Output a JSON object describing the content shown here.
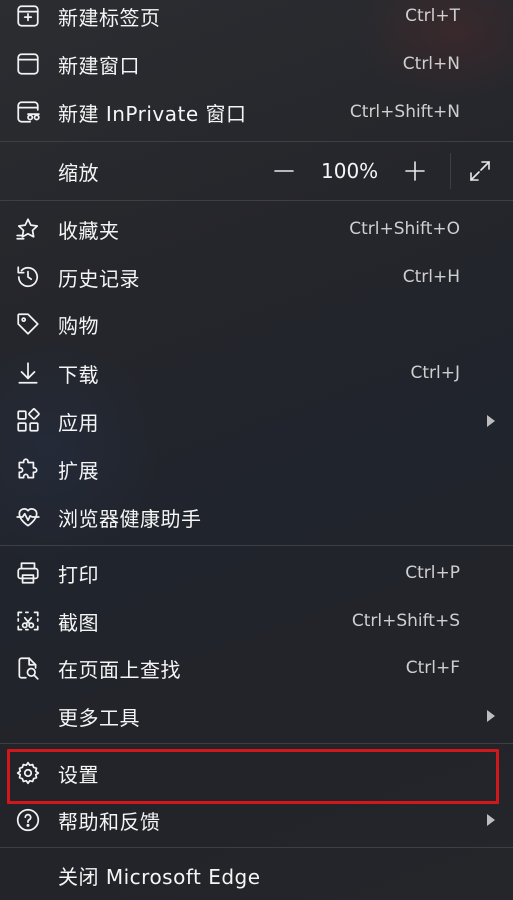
{
  "menu": {
    "new_tab": {
      "label": "新建标签页",
      "shortcut": "Ctrl+T"
    },
    "new_window": {
      "label": "新建窗口",
      "shortcut": "Ctrl+N"
    },
    "new_inprivate": {
      "label": "新建 InPrivate 窗口",
      "shortcut": "Ctrl+Shift+N"
    },
    "zoom": {
      "label": "缩放",
      "value": "100%"
    },
    "favorites": {
      "label": "收藏夹",
      "shortcut": "Ctrl+Shift+O"
    },
    "history": {
      "label": "历史记录",
      "shortcut": "Ctrl+H"
    },
    "shopping": {
      "label": "购物"
    },
    "downloads": {
      "label": "下载",
      "shortcut": "Ctrl+J"
    },
    "apps": {
      "label": "应用"
    },
    "extensions": {
      "label": "扩展"
    },
    "health": {
      "label": "浏览器健康助手"
    },
    "print": {
      "label": "打印",
      "shortcut": "Ctrl+P"
    },
    "screenshot": {
      "label": "截图",
      "shortcut": "Ctrl+Shift+S"
    },
    "find": {
      "label": "在页面上查找",
      "shortcut": "Ctrl+F"
    },
    "more_tools": {
      "label": "更多工具"
    },
    "settings": {
      "label": "设置"
    },
    "help": {
      "label": "帮助和反馈"
    },
    "close": {
      "label": "关闭 Microsoft Edge"
    }
  },
  "colors": {
    "highlight_border": "#d0171c",
    "background": "#25262b",
    "divider": "#3d3f45"
  }
}
